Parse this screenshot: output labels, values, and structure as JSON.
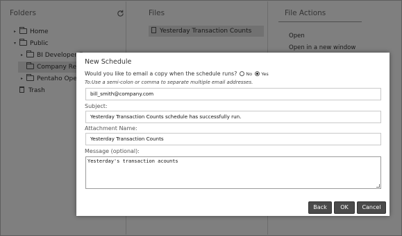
{
  "panes": {
    "folders": {
      "title": "Folders",
      "items": [
        {
          "label": "Home",
          "toggle": "▸"
        },
        {
          "label": "Public",
          "toggle": "▾"
        },
        {
          "label": "BI Developer Ex",
          "toggle": "▸"
        },
        {
          "label": "Company Repor",
          "toggle": ""
        },
        {
          "label": "Pentaho Operat",
          "toggle": "▸"
        },
        {
          "label": "Trash",
          "toggle": ""
        }
      ]
    },
    "files": {
      "title": "Files",
      "items": [
        {
          "label": "Yesterday Transaction Counts"
        }
      ]
    },
    "actions": {
      "title": "File Actions",
      "items": [
        {
          "label": "Open"
        },
        {
          "label": "Open in a new window"
        }
      ]
    }
  },
  "dialog": {
    "title": "New Schedule",
    "question": "Would you like to email a copy when the schedule runs?",
    "options": {
      "no": "No",
      "yes": "Yes",
      "selected": "yes"
    },
    "to_hint": "To:Use a semi-colon or comma to separate multiple email addresses.",
    "to_value": "bill_smith@company.com",
    "subject_label": "Subject:",
    "subject_value": "Yesterday Transaction Counts schedule has successfully run.",
    "attachment_label": "Attachment Name:",
    "attachment_value": "Yesterday Transaction Counts",
    "message_label": "Message (optional):",
    "message_value": "Yesterday's transaction acounts",
    "buttons": {
      "back": "Back",
      "ok": "OK",
      "cancel": "Cancel"
    }
  },
  "colors": {
    "overlay": "#000000",
    "button": "#4a4a4a",
    "selection": "#e3e3e3"
  }
}
